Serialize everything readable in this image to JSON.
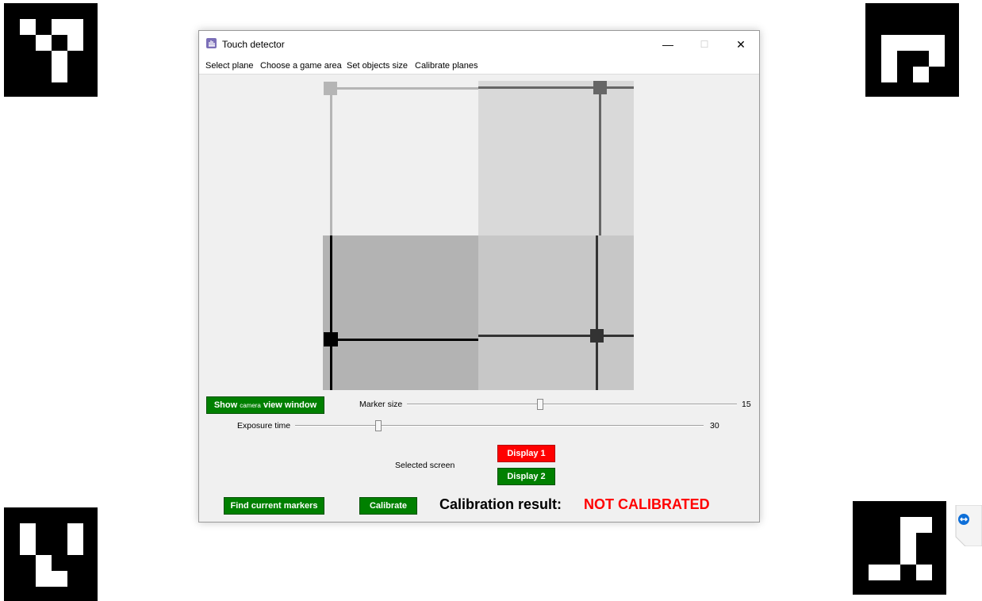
{
  "window": {
    "title": "Touch detector",
    "controls": {
      "minimize": "—",
      "maximize": "☐",
      "close": "✕"
    }
  },
  "menu": {
    "items": [
      {
        "label": "Select plane"
      },
      {
        "label": "Choose a game area"
      },
      {
        "label": "Set objects size"
      },
      {
        "label": "Calibrate planes"
      }
    ]
  },
  "camera_button": {
    "label_prefix": "Show ",
    "label_small": "camera",
    "label_suffix": " view window"
  },
  "marker_size": {
    "label": "Marker size",
    "value": "15",
    "fraction": 0.405
  },
  "exposure_time": {
    "label": "Exposure time",
    "value": "30",
    "fraction": 0.203
  },
  "screens": {
    "label": "Selected screen",
    "options": [
      {
        "label": "Display 1",
        "color": "#ff0000",
        "selected": false
      },
      {
        "label": "Display 2",
        "color": "#008000",
        "selected": true
      }
    ]
  },
  "actions": {
    "find_markers": "Find current markers",
    "calibrate": "Calibrate"
  },
  "calibration": {
    "label": "Calibration result:",
    "value": "NOT CALIBRATED",
    "value_color": "#ff0000"
  },
  "colors": {
    "button_green": "#008000",
    "button_red": "#ff0000"
  }
}
